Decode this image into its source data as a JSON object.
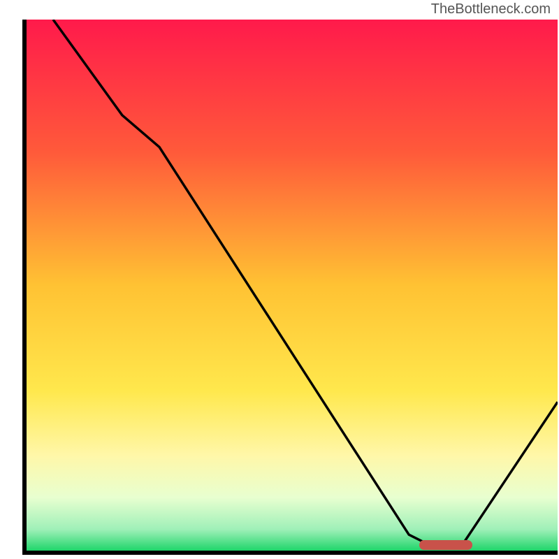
{
  "watermark": "TheBottleneck.com",
  "chart_data": {
    "type": "line",
    "title": "",
    "xlabel": "",
    "ylabel": "",
    "xlim": [
      0,
      100
    ],
    "ylim": [
      0,
      100
    ],
    "gradient_stops": [
      {
        "offset": 0,
        "color": "#ff1a4b"
      },
      {
        "offset": 0.25,
        "color": "#ff5a3a"
      },
      {
        "offset": 0.5,
        "color": "#ffc233"
      },
      {
        "offset": 0.7,
        "color": "#ffe84d"
      },
      {
        "offset": 0.82,
        "color": "#fff7a8"
      },
      {
        "offset": 0.9,
        "color": "#e8ffd0"
      },
      {
        "offset": 0.96,
        "color": "#9ff0b8"
      },
      {
        "offset": 1.0,
        "color": "#1fd56a"
      }
    ],
    "series": [
      {
        "name": "bottleneck-curve",
        "points": [
          {
            "x": 5,
            "y": 100
          },
          {
            "x": 18,
            "y": 82
          },
          {
            "x": 25,
            "y": 76
          },
          {
            "x": 72,
            "y": 3
          },
          {
            "x": 76,
            "y": 1
          },
          {
            "x": 82,
            "y": 1
          },
          {
            "x": 100,
            "y": 28
          }
        ]
      }
    ],
    "marker": {
      "x_start": 74,
      "x_end": 84,
      "y": 1
    }
  }
}
